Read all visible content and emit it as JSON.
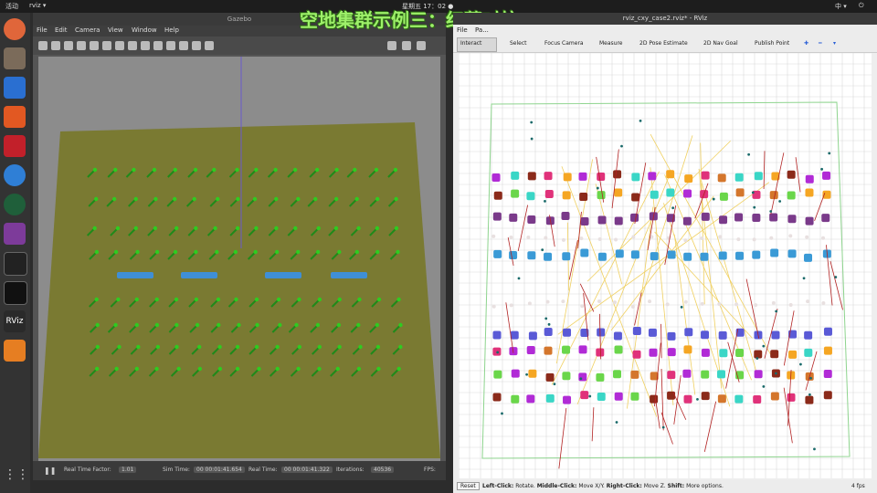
{
  "topbar": {
    "activities": "活动",
    "app": "rviz ▾",
    "clock": "星期五 17：02 ●",
    "lang": "中 ▾"
  },
  "overlay_title": "空地集群示例三：红蓝对抗",
  "gazebo": {
    "title": "Gazebo",
    "menu": [
      "File",
      "Edit",
      "Camera",
      "View",
      "Window",
      "Help"
    ],
    "status": {
      "real_time_factor_label": "Real Time Factor:",
      "real_time_factor": "1.01",
      "sim_time_label": "Sim Time:",
      "sim_time": "00 00:01:41.654",
      "real_time_label": "Real Time:",
      "real_time": "00 00:01:41.322",
      "iterations_label": "Iterations:",
      "iterations": "40536",
      "fps": "FPS:"
    }
  },
  "rviz": {
    "title": "rviz_cxy_case2.rviz* - RViz",
    "menu": [
      "File",
      "Pa..."
    ],
    "tools": [
      "Interact",
      "Select",
      "Focus Camera",
      "Measure",
      "2D Pose Estimate",
      "2D Nav Goal",
      "Publish Point"
    ],
    "status": {
      "reset": "Reset",
      "left_click": "Left-Click:",
      "left_text": " Rotate. ",
      "middle_click": "Middle-Click:",
      "middle_text": " Move X/Y. ",
      "right_click": "Right-Click:",
      "right_text": " Move Z. ",
      "shift": "Shift:",
      "shift_text": " More options.",
      "fps": "4 fps"
    }
  },
  "colors": {
    "grass": "#7a7a32",
    "drone_green": "#2ecc20",
    "rviz_orange": "#f5a623",
    "rviz_purple": "#b12bd6",
    "rviz_red": "#b22222",
    "grid": "#d9d9d9"
  }
}
